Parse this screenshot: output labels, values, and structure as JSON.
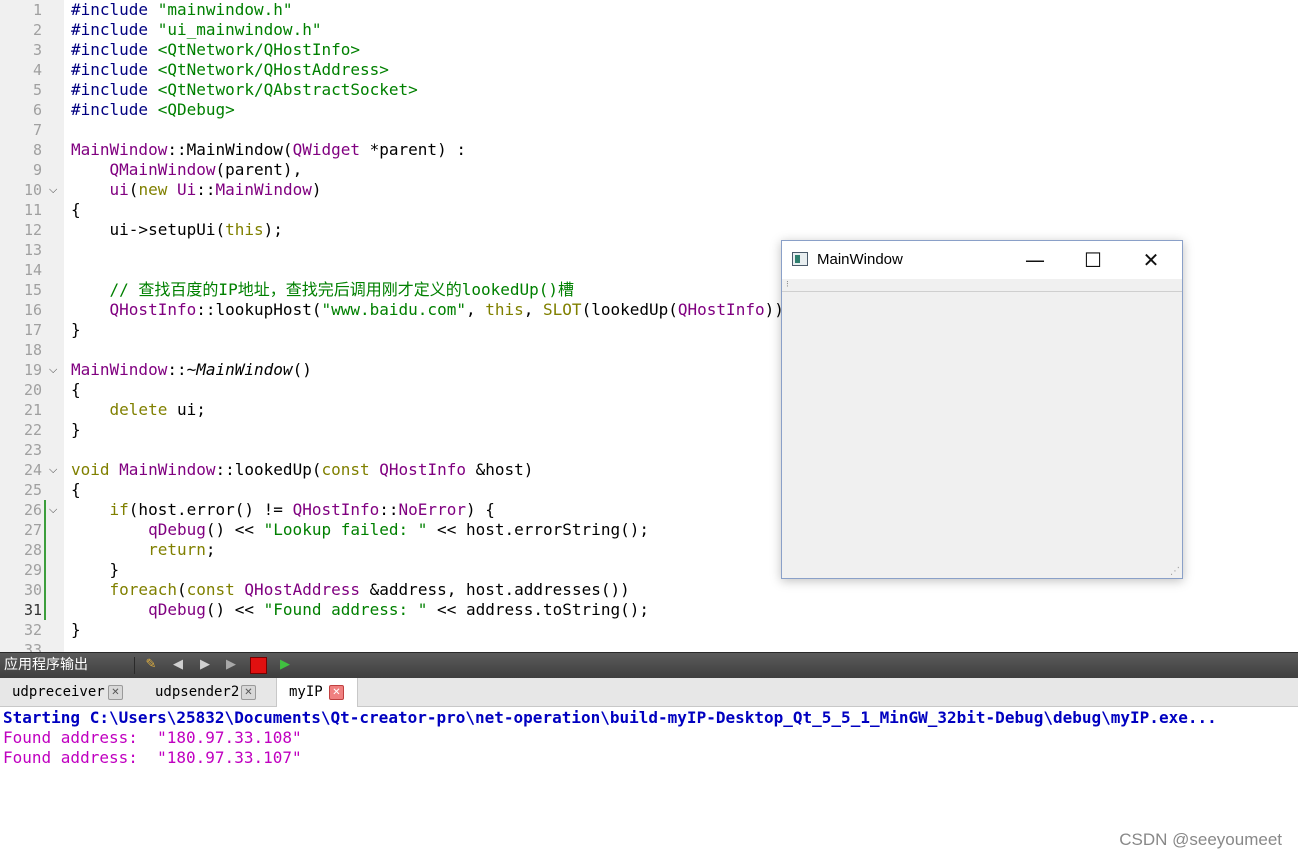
{
  "editor": {
    "current_line": 31,
    "lines": [
      {
        "n": 1,
        "fold": false,
        "changed": false,
        "tokens": [
          [
            "pp",
            "#include "
          ],
          [
            "str",
            "\"mainwindow.h\""
          ]
        ]
      },
      {
        "n": 2,
        "fold": false,
        "changed": false,
        "tokens": [
          [
            "pp",
            "#include "
          ],
          [
            "str",
            "\"ui_mainwindow.h\""
          ]
        ]
      },
      {
        "n": 3,
        "fold": false,
        "changed": false,
        "tokens": [
          [
            "pp",
            "#include "
          ],
          [
            "str",
            "<QtNetwork/QHostInfo>"
          ]
        ]
      },
      {
        "n": 4,
        "fold": false,
        "changed": false,
        "tokens": [
          [
            "pp",
            "#include "
          ],
          [
            "str",
            "<QtNetwork/QHostAddress>"
          ]
        ]
      },
      {
        "n": 5,
        "fold": false,
        "changed": false,
        "tokens": [
          [
            "pp",
            "#include "
          ],
          [
            "str",
            "<QtNetwork/QAbstractSocket>"
          ]
        ]
      },
      {
        "n": 6,
        "fold": false,
        "changed": false,
        "tokens": [
          [
            "pp",
            "#include "
          ],
          [
            "str",
            "<QDebug>"
          ]
        ]
      },
      {
        "n": 7,
        "fold": false,
        "changed": false,
        "tokens": []
      },
      {
        "n": 8,
        "fold": false,
        "changed": false,
        "tokens": [
          [
            "ty",
            "MainWindow"
          ],
          [
            "",
            "::MainWindow("
          ],
          [
            "ty",
            "QWidget"
          ],
          [
            "",
            " *parent) :"
          ]
        ]
      },
      {
        "n": 9,
        "fold": false,
        "changed": false,
        "tokens": [
          [
            "",
            "    "
          ],
          [
            "ty",
            "QMainWindow"
          ],
          [
            "",
            "(parent),"
          ]
        ]
      },
      {
        "n": 10,
        "fold": true,
        "changed": false,
        "tokens": [
          [
            "",
            "    "
          ],
          [
            "ty",
            "ui"
          ],
          [
            "",
            "("
          ],
          [
            "kw",
            "new"
          ],
          [
            "",
            " "
          ],
          [
            "ty",
            "Ui"
          ],
          [
            "",
            "::"
          ],
          [
            "ty",
            "MainWindow"
          ],
          [
            "",
            ")"
          ]
        ]
      },
      {
        "n": 11,
        "fold": false,
        "changed": false,
        "tokens": [
          [
            "",
            "{"
          ]
        ]
      },
      {
        "n": 12,
        "fold": false,
        "changed": false,
        "tokens": [
          [
            "",
            "    ui->setupUi("
          ],
          [
            "kw",
            "this"
          ],
          [
            "",
            ");"
          ]
        ]
      },
      {
        "n": 13,
        "fold": false,
        "changed": false,
        "tokens": []
      },
      {
        "n": 14,
        "fold": false,
        "changed": false,
        "tokens": []
      },
      {
        "n": 15,
        "fold": false,
        "changed": false,
        "tokens": [
          [
            "",
            "    "
          ],
          [
            "cm",
            "// 查找百度的IP地址，查找完后调用刚才定义的lookedUp()槽"
          ]
        ]
      },
      {
        "n": 16,
        "fold": false,
        "changed": false,
        "tokens": [
          [
            "",
            "    "
          ],
          [
            "ty",
            "QHostInfo"
          ],
          [
            "",
            "::lookupHost("
          ],
          [
            "str",
            "\"www.baidu.com\""
          ],
          [
            "",
            ", "
          ],
          [
            "kw",
            "this"
          ],
          [
            "",
            ", "
          ],
          [
            "kw",
            "SLOT"
          ],
          [
            "",
            "(lookedUp("
          ],
          [
            "ty",
            "QHostInfo"
          ],
          [
            "",
            ")));"
          ]
        ]
      },
      {
        "n": 17,
        "fold": false,
        "changed": false,
        "tokens": [
          [
            "",
            "}"
          ]
        ]
      },
      {
        "n": 18,
        "fold": false,
        "changed": false,
        "tokens": []
      },
      {
        "n": 19,
        "fold": true,
        "changed": false,
        "tokens": [
          [
            "ty",
            "MainWindow"
          ],
          [
            "",
            "::~"
          ],
          [
            "it",
            "MainWindow"
          ],
          [
            "",
            "()"
          ]
        ]
      },
      {
        "n": 20,
        "fold": false,
        "changed": false,
        "tokens": [
          [
            "",
            "{"
          ]
        ]
      },
      {
        "n": 21,
        "fold": false,
        "changed": false,
        "tokens": [
          [
            "",
            "    "
          ],
          [
            "kw",
            "delete"
          ],
          [
            "",
            " ui;"
          ]
        ]
      },
      {
        "n": 22,
        "fold": false,
        "changed": false,
        "tokens": [
          [
            "",
            "}"
          ]
        ]
      },
      {
        "n": 23,
        "fold": false,
        "changed": false,
        "tokens": []
      },
      {
        "n": 24,
        "fold": true,
        "changed": false,
        "tokens": [
          [
            "kw",
            "void"
          ],
          [
            "",
            " "
          ],
          [
            "ty",
            "MainWindow"
          ],
          [
            "",
            "::lookedUp("
          ],
          [
            "kw",
            "const"
          ],
          [
            "",
            " "
          ],
          [
            "ty",
            "QHostInfo"
          ],
          [
            "",
            " &host)"
          ]
        ]
      },
      {
        "n": 25,
        "fold": false,
        "changed": false,
        "tokens": [
          [
            "",
            "{"
          ]
        ]
      },
      {
        "n": 26,
        "fold": true,
        "changed": true,
        "tokens": [
          [
            "",
            "    "
          ],
          [
            "kw",
            "if"
          ],
          [
            "",
            "(host.error() != "
          ],
          [
            "ty",
            "QHostInfo"
          ],
          [
            "",
            "::"
          ],
          [
            "ty",
            "NoError"
          ],
          [
            "",
            ") {"
          ]
        ]
      },
      {
        "n": 27,
        "fold": false,
        "changed": true,
        "tokens": [
          [
            "",
            "        "
          ],
          [
            "ty",
            "qDebug"
          ],
          [
            "",
            "() << "
          ],
          [
            "str",
            "\"Lookup failed: \""
          ],
          [
            "",
            " << host.errorString();"
          ]
        ]
      },
      {
        "n": 28,
        "fold": false,
        "changed": true,
        "tokens": [
          [
            "",
            "        "
          ],
          [
            "kw",
            "return"
          ],
          [
            "",
            ";"
          ]
        ]
      },
      {
        "n": 29,
        "fold": false,
        "changed": true,
        "tokens": [
          [
            "",
            "    }"
          ]
        ]
      },
      {
        "n": 30,
        "fold": false,
        "changed": true,
        "tokens": [
          [
            "",
            "    "
          ],
          [
            "kw",
            "foreach"
          ],
          [
            "",
            "("
          ],
          [
            "kw",
            "const"
          ],
          [
            "",
            " "
          ],
          [
            "ty",
            "QHostAddress"
          ],
          [
            "",
            " &address, host.addresses())"
          ]
        ]
      },
      {
        "n": 31,
        "fold": false,
        "changed": true,
        "tokens": [
          [
            "",
            "        "
          ],
          [
            "ty",
            "qDebug"
          ],
          [
            "",
            "() << "
          ],
          [
            "str",
            "\"Found address: \""
          ],
          [
            "",
            " << address.toString();"
          ]
        ]
      },
      {
        "n": 32,
        "fold": false,
        "changed": false,
        "tokens": [
          [
            "",
            "}"
          ]
        ]
      },
      {
        "n": 33,
        "fold": false,
        "changed": false,
        "tokens": []
      }
    ]
  },
  "app_window": {
    "title": "MainWindow",
    "minimize": "—",
    "maximize": "☐",
    "close": "✕",
    "toolbar_grip": "⁝",
    "resize_grip": "⋰"
  },
  "output": {
    "title": "应用程序输出",
    "buttons": {
      "clear": "✎",
      "prev": "◀",
      "next": "▶",
      "run": "▶",
      "debug": "▶"
    },
    "tabs": [
      {
        "label": "udpreceiver",
        "close": "✕"
      },
      {
        "label": "udpsender2",
        "close": "✕"
      },
      {
        "label": "myIP",
        "close": "✕"
      }
    ],
    "active_tab": "myIP",
    "lines": {
      "start": "Starting C:\\Users\\25832\\Documents\\Qt-creator-pro\\net-operation\\build-myIP-Desktop_Qt_5_5_1_MinGW_32bit-Debug\\debug\\myIP.exe...",
      "line1": "Found address:  \"180.97.33.108\"",
      "line2": "Found address:  \"180.97.33.107\""
    }
  },
  "watermark": "CSDN @seeyoumeet",
  "colors": {
    "preprocessor": "#000080",
    "string": "#008000",
    "type": "#800080",
    "keyword": "#808000",
    "output_start": "#0000c0",
    "output_text": "#c000c0",
    "changed_bar": "#3c9e3c"
  }
}
